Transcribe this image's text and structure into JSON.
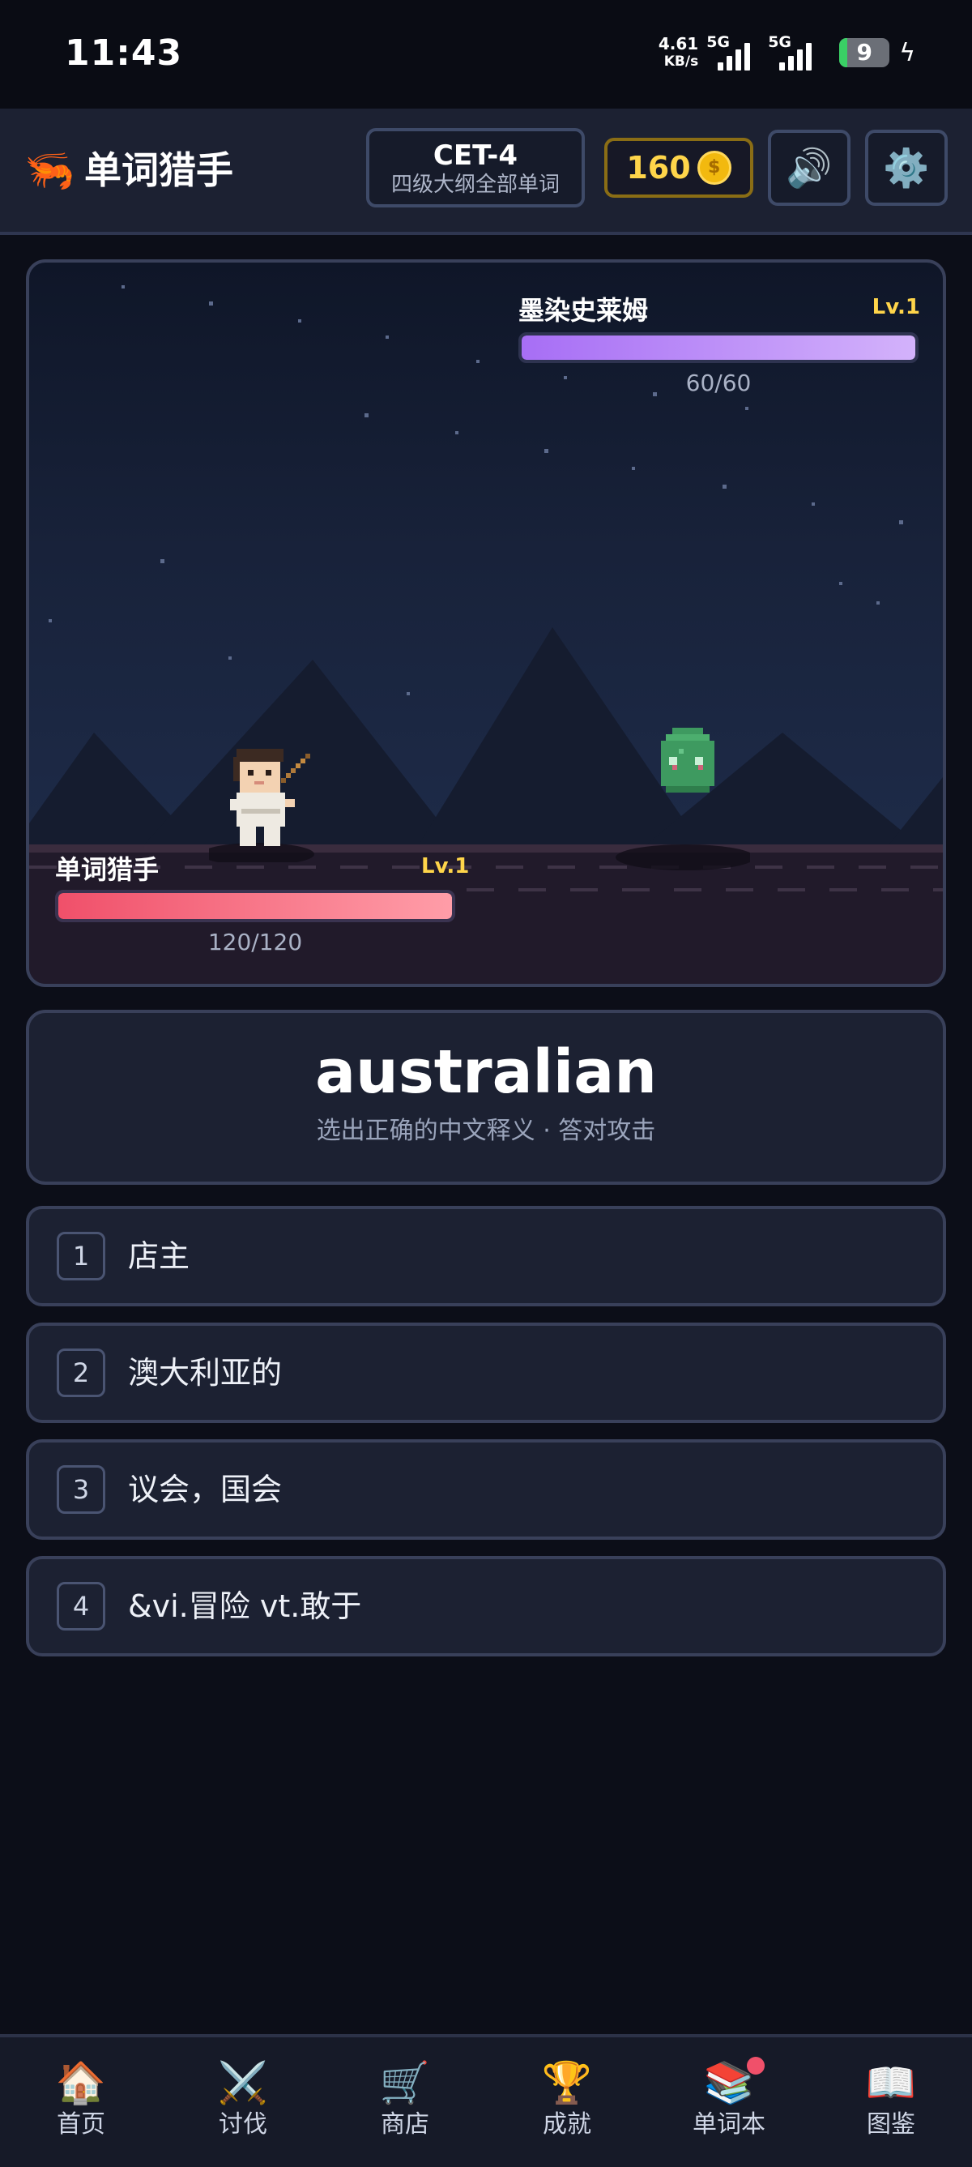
{
  "status_bar": {
    "time": "11:43",
    "net_speed": "4.61",
    "net_unit": "KB/s",
    "signal_1": "5G",
    "signal_2": "5G",
    "battery": "9"
  },
  "header": {
    "title": "单词猎手",
    "logo_icon": "shrimp-icon",
    "level_title": "CET-4",
    "level_sub": "四级大纲全部单词",
    "coins": "160",
    "coin_icon": "coin-icon",
    "sound_icon": "speaker-icon",
    "settings_icon": "gear-icon"
  },
  "battle": {
    "enemy": {
      "name": "墨染史莱姆",
      "level": "Lv.1",
      "hp_text": "60/60",
      "hp_fraction": 1.0
    },
    "player": {
      "name": "单词猎手",
      "level": "Lv.1",
      "hp_text": "120/120",
      "hp_fraction": 1.0
    }
  },
  "quiz": {
    "word": "australian",
    "hint": "选出正确的中文释义 · 答对攻击",
    "options": [
      {
        "num": "1",
        "text": "店主"
      },
      {
        "num": "2",
        "text": "澳大利亚的"
      },
      {
        "num": "3",
        "text": "议会，国会"
      },
      {
        "num": "4",
        "text": "&vi.冒险 vt.敢于"
      }
    ]
  },
  "nav": {
    "items": [
      {
        "label": "首页",
        "icon": "house-icon",
        "glyph": "🏠"
      },
      {
        "label": "讨伐",
        "icon": "crossed-swords-icon",
        "glyph": "⚔️"
      },
      {
        "label": "商店",
        "icon": "cart-icon",
        "glyph": "🛒"
      },
      {
        "label": "成就",
        "icon": "trophy-icon",
        "glyph": "🏆"
      },
      {
        "label": "单词本",
        "icon": "books-icon",
        "glyph": "📚"
      },
      {
        "label": "图鉴",
        "icon": "open-book-icon",
        "glyph": "📖"
      }
    ]
  },
  "colors": {
    "background": "#0c0e18",
    "panel": "#1c2132",
    "accent_gold": "#ffd54a",
    "enemy_hp": "#b88af7",
    "player_hp": "#f0506a"
  }
}
